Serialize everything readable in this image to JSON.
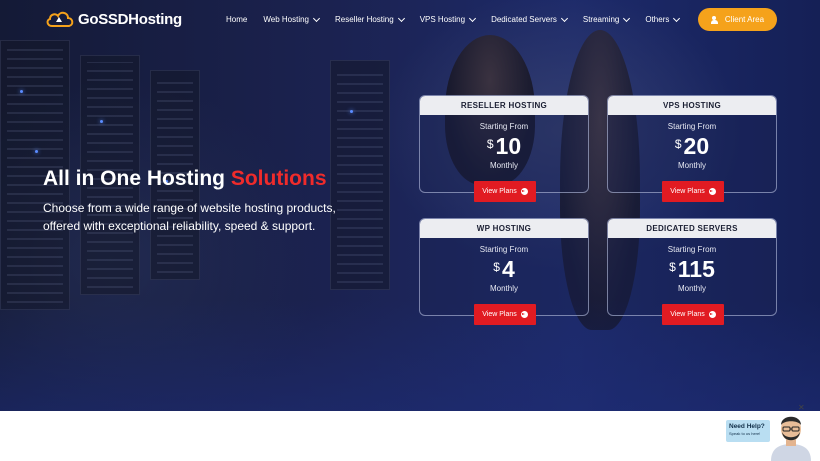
{
  "brand": {
    "name": "GoSSDHosting"
  },
  "nav": {
    "items": [
      {
        "label": "Home",
        "dropdown": false
      },
      {
        "label": "Web Hosting",
        "dropdown": true
      },
      {
        "label": "Reseller Hosting",
        "dropdown": true
      },
      {
        "label": "VPS Hosting",
        "dropdown": true
      },
      {
        "label": "Dedicated Servers",
        "dropdown": true
      },
      {
        "label": "Streaming",
        "dropdown": true
      },
      {
        "label": "Others",
        "dropdown": true
      }
    ],
    "client_area": "Client Area"
  },
  "hero": {
    "headline_main": "All in One Hosting ",
    "headline_accent": "Solutions",
    "subtext": "Choose from a wide range of website hosting products, offered with exceptional reliability, speed & support."
  },
  "plans": [
    {
      "title": "RESELLER HOSTING",
      "from": "Starting From",
      "currency": "$",
      "price": "10",
      "period": "Monthly",
      "cta": "View Plans"
    },
    {
      "title": "VPS HOSTING",
      "from": "Starting From",
      "currency": "$",
      "price": "20",
      "period": "Monthly",
      "cta": "View Plans"
    },
    {
      "title": "WP HOSTING",
      "from": "Starting From",
      "currency": "$",
      "price": "4",
      "period": "Monthly",
      "cta": "View Plans"
    },
    {
      "title": "DEDICATED SERVERS",
      "from": "Starting From",
      "currency": "$",
      "price": "115",
      "period": "Monthly",
      "cta": "View Plans"
    }
  ],
  "help": {
    "title": "Need Help?",
    "subtitle": "Speak to us here!",
    "close": "✕"
  },
  "colors": {
    "accent_red": "#e11b22",
    "headline_red": "#ef2b2b",
    "client_orange": "#f5a21b",
    "hero_navy": "#1b2250"
  },
  "icons": {
    "logo": "cloud-logo-icon",
    "client": "user-icon",
    "cta": "arrow-circle-icon",
    "nav_dropdown": "chevron-down-icon"
  }
}
